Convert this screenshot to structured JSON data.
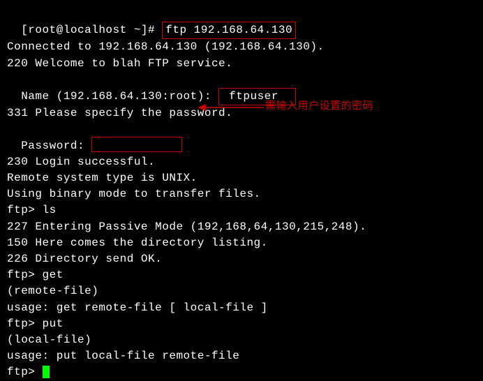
{
  "prompt": {
    "shell": "[root@localhost ~]# ",
    "ftp_cmd": "ftp 192.168.64.130"
  },
  "lines": {
    "connected": "Connected to 192.168.64.130 (192.168.64.130).",
    "welcome": "220 Welcome to blah FTP service.",
    "name_prompt": "Name (192.168.64.130:root): ",
    "name_input": "ftpuser",
    "specify_pw": "331 Please specify the password.",
    "password_label": "Password: ",
    "login_ok": "230 Login successful.",
    "remote_system": "Remote system type is UNIX.",
    "binary_mode": "Using binary mode to transfer files.",
    "ftp_prompt": "ftp> ",
    "cmd_ls": "ls",
    "passive": "227 Entering Passive Mode (192,168,64,130,215,248).",
    "dir_listing": "150 Here comes the directory listing.",
    "dir_ok": "226 Directory send OK.",
    "cmd_get": "get",
    "remote_file": "(remote-file) ",
    "usage_get": "usage: get remote-file [ local-file ]",
    "cmd_put": "put",
    "local_file": "(local-file) ",
    "usage_put": "usage: put local-file remote-file"
  },
  "annotation": {
    "text": "需输入用户设置的密码"
  }
}
